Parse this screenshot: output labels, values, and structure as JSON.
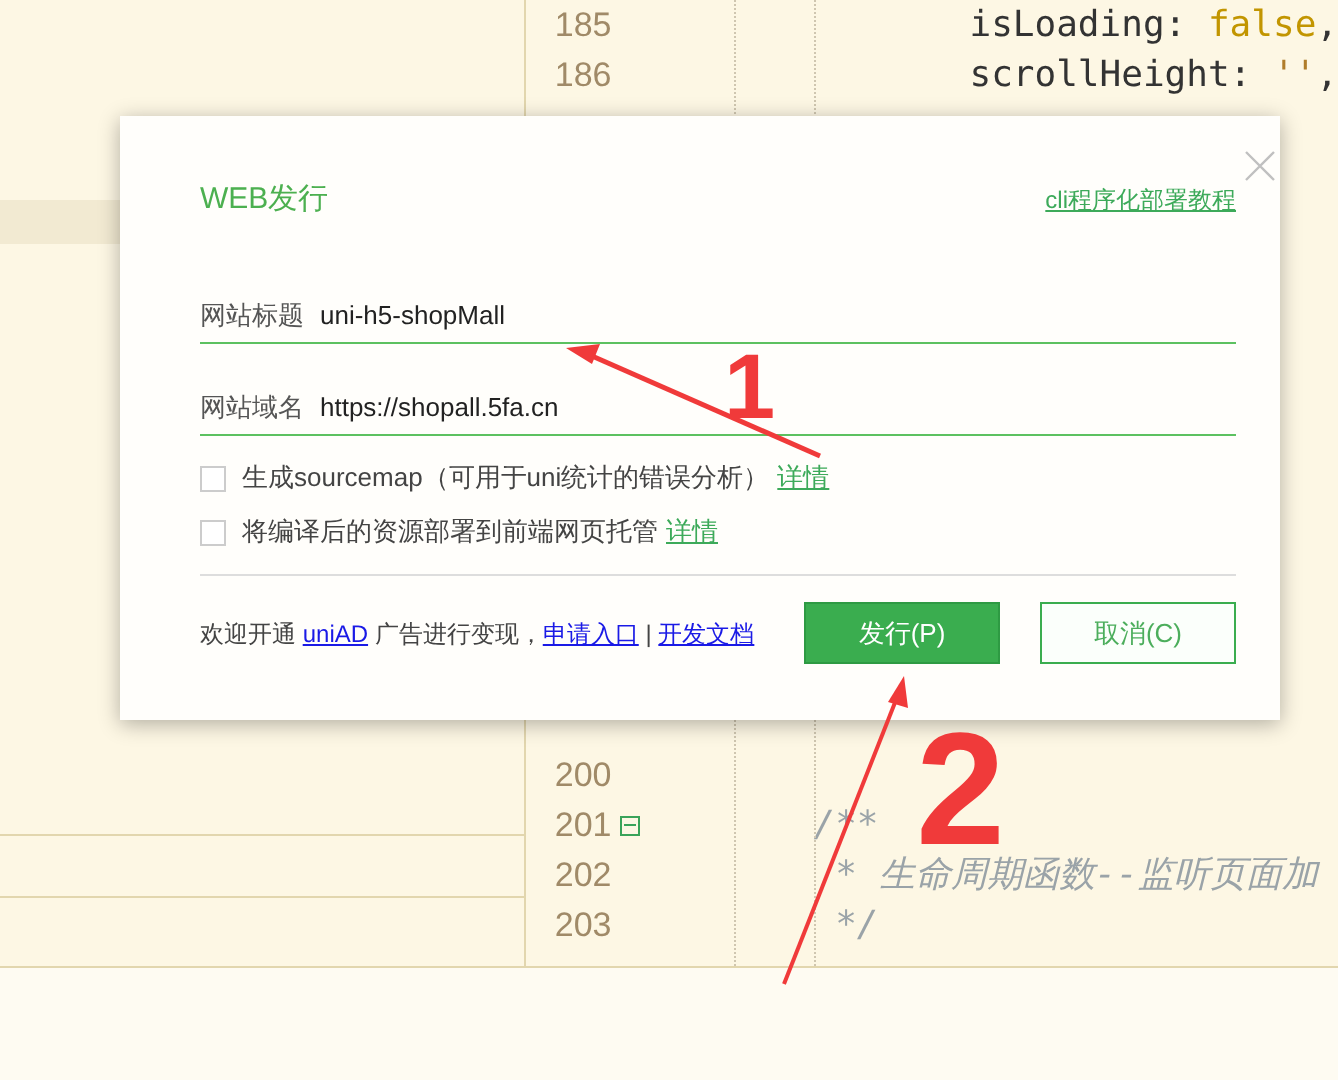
{
  "editor": {
    "lines_top": [
      {
        "number": "185",
        "fold": false,
        "code": [
          {
            "text": "isLoading: ",
            "kind": "plain"
          },
          {
            "text": "false",
            "kind": "keyword"
          },
          {
            "text": ",",
            "kind": "plain"
          }
        ]
      },
      {
        "number": "186",
        "fold": false,
        "code": [
          {
            "text": "scrollHeight: ",
            "kind": "plain"
          },
          {
            "text": "''",
            "kind": "string"
          },
          {
            "text": ",",
            "kind": "plain"
          }
        ]
      }
    ],
    "lines_bottom": [
      {
        "number": "200",
        "fold": false
      },
      {
        "number": "201",
        "fold": true,
        "code": [
          {
            "text": "/**",
            "kind": "comment"
          }
        ]
      },
      {
        "number": "202",
        "fold": false,
        "code": [
          {
            "text": " * 生命周期函数--监听页面加",
            "kind": "comment"
          }
        ]
      },
      {
        "number": "203",
        "fold": false,
        "code": [
          {
            "text": " */",
            "kind": "comment"
          }
        ]
      }
    ]
  },
  "dialog": {
    "title": "WEB发行",
    "help_link": "cli程序化部署教程",
    "fields": [
      {
        "label": "网站标题",
        "value": "uni-h5-shopMall"
      },
      {
        "label": "网站域名",
        "value": "https://shopall.5fa.cn"
      }
    ],
    "options": [
      {
        "label": "生成sourcemap（可用于uni统计的错误分析）",
        "link": "详情",
        "checked": false
      },
      {
        "label": "将编译后的资源部署到前端网页托管",
        "link": "详情",
        "checked": false
      }
    ],
    "footer": {
      "parts": [
        {
          "text": "欢迎开通 ",
          "kind": "text"
        },
        {
          "text": "uniAD",
          "kind": "link"
        },
        {
          "text": " 广告进行变现，",
          "kind": "text"
        },
        {
          "text": "申请入口",
          "kind": "link"
        },
        {
          "text": " | ",
          "kind": "text"
        },
        {
          "text": "开发文档",
          "kind": "link"
        }
      ]
    },
    "buttons": [
      {
        "label": "发行(P)",
        "kind": "primary"
      },
      {
        "label": "取消(C)",
        "kind": "secondary"
      }
    ]
  },
  "annotations": [
    {
      "text": "1"
    },
    {
      "text": "2"
    }
  ]
}
